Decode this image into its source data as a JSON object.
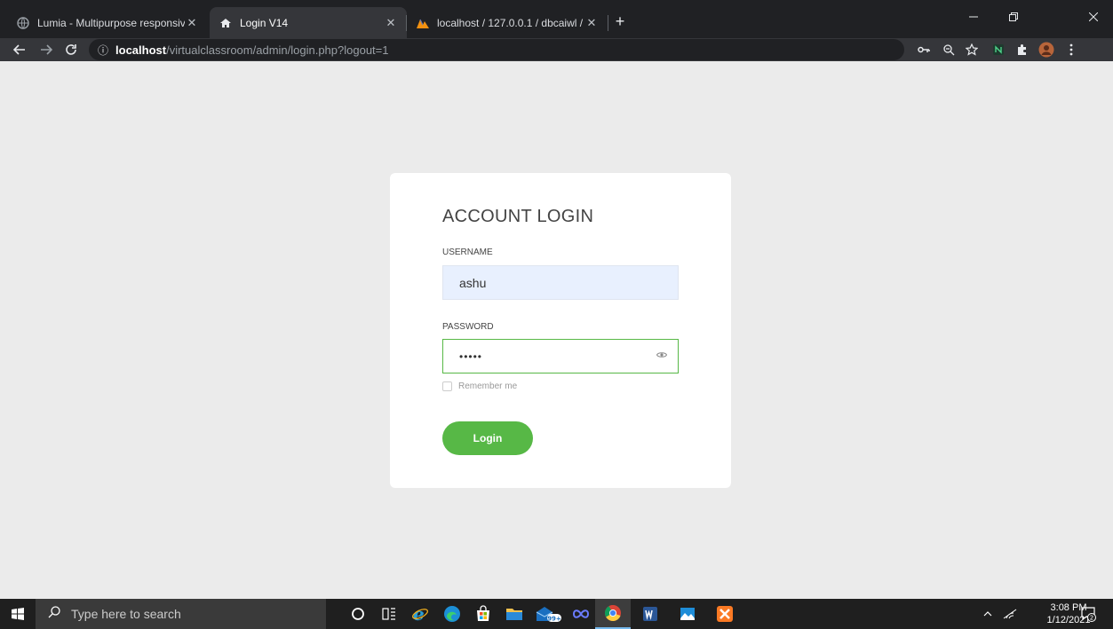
{
  "browser": {
    "tabs": [
      {
        "title": "Lumia - Multipurpose responsive",
        "icon": "globe-icon"
      },
      {
        "title": "Login V14",
        "icon": "home-icon"
      },
      {
        "title": "localhost / 127.0.0.1 / dbcaiwl / t",
        "icon": "phpmyadmin-icon"
      }
    ],
    "tab_close_glyph": "✕",
    "new_tab_glyph": "+",
    "url_host": "localhost",
    "url_path": "/virtualclassroom/admin/login.php?logout=1",
    "info_glyph": "ⓘ"
  },
  "login": {
    "title": "ACCOUNT LOGIN",
    "username_label": "USERNAME",
    "username_value": "ashu",
    "password_label": "PASSWORD",
    "password_value": "12345",
    "remember_label": "Remember me",
    "button_label": "Login",
    "accent_color": "#57b846"
  },
  "taskbar": {
    "search_placeholder": "Type here to search",
    "badge_count": "99+",
    "time": "3:08 PM",
    "date": "1/12/2021",
    "notification_count": "2"
  }
}
